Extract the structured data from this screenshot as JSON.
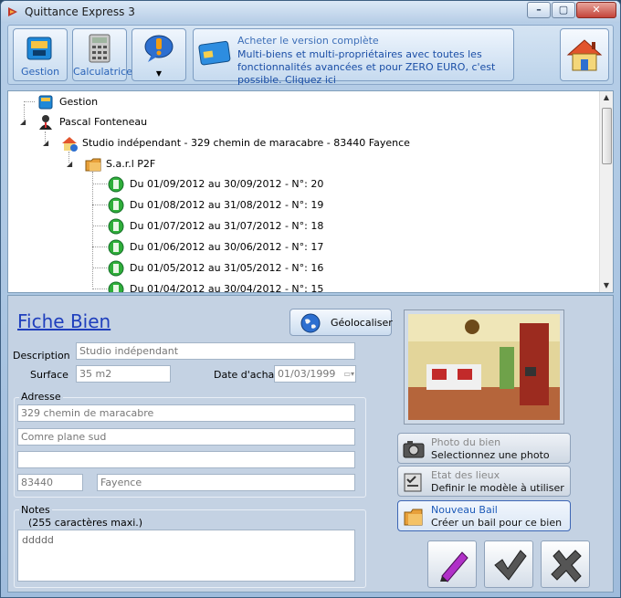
{
  "window": {
    "title": "Quittance Express 3"
  },
  "toolbar": {
    "gestion_label": "Gestion",
    "calculatrice_label": "Calculatrice",
    "promo_title": "Acheter le version complète",
    "promo_text": "Multi-biens et multi-propriétaires avec toutes les fonctionnalités avancées et pour ZERO EURO, c'est possible. Cliquez ici"
  },
  "tree": {
    "root": "Gestion",
    "owner": "Pascal Fonteneau",
    "property": "Studio indépendant - 329 chemin de maracabre - 83440 Fayence",
    "tenant": "S.a.r.l P2F",
    "receipts": [
      "Du 01/09/2012 au 30/09/2012 - N°: 20",
      "Du 01/08/2012 au 31/08/2012 - N°: 19",
      "Du 01/07/2012 au 31/07/2012 - N°: 18",
      "Du 01/06/2012 au 30/06/2012 - N°: 17",
      "Du 01/05/2012 au 31/05/2012 - N°: 16",
      "Du 01/04/2012 au 30/04/2012 - N°: 15"
    ]
  },
  "form": {
    "title": "Fiche Bien",
    "geo_label": "Géolocaliser",
    "description_label": "Description",
    "description_value": "Studio indépendant",
    "surface_label": "Surface",
    "surface_value": "35 m2",
    "date_label": "Date d'achat",
    "date_value": "01/03/1999",
    "address_group": "Adresse",
    "address1": "329 chemin de maracabre",
    "address2": "Comre plane sud",
    "address3": "",
    "zip": "83440",
    "city": "Fayence",
    "notes_group": "Notes",
    "notes_hint": "(255 caractères maxi.)",
    "notes_value": "ddddd"
  },
  "side": {
    "photo_t1": "Photo du bien",
    "photo_t2": "Selectionnez une photo",
    "etat_t1": "Etat des lieux",
    "etat_t2": "Definir le modèle à utiliser",
    "bail_t1": "Nouveau Bail",
    "bail_t2": "Créer un bail pour ce bien"
  }
}
